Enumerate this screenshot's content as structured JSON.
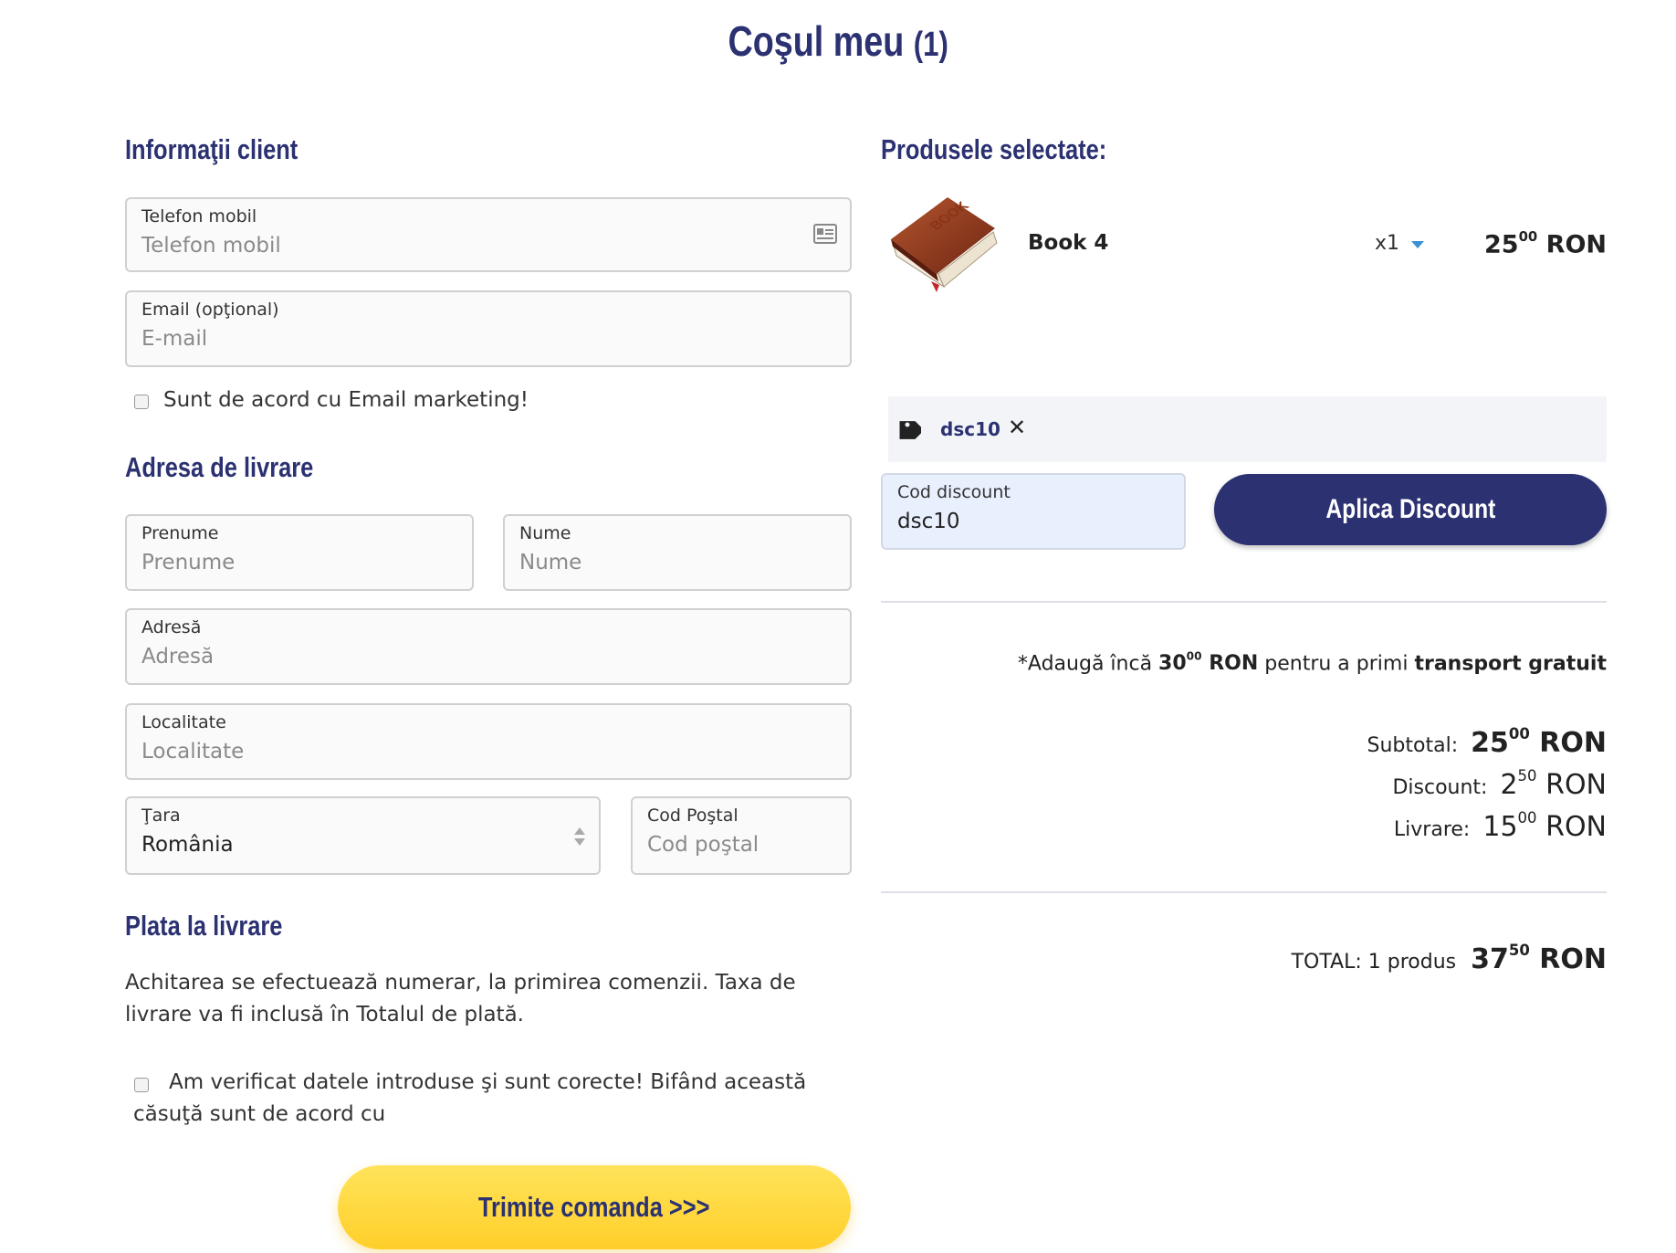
{
  "page": {
    "title": "Coşul meu",
    "count": "(1)"
  },
  "client": {
    "heading": "Informaţii client",
    "phone": {
      "label": "Telefon mobil",
      "placeholder": "Telefon mobil",
      "icon": "contact-card-icon"
    },
    "email": {
      "label": "Email (opţional)",
      "placeholder": "E-mail"
    },
    "marketing_label": "Sunt de acord cu Email marketing!"
  },
  "shipping": {
    "heading": "Adresa de livrare",
    "first_name": {
      "label": "Prenume",
      "placeholder": "Prenume"
    },
    "last_name": {
      "label": "Nume",
      "placeholder": "Nume"
    },
    "address": {
      "label": "Adresă",
      "placeholder": "Adresă"
    },
    "city": {
      "label": "Localitate",
      "placeholder": "Localitate"
    },
    "country": {
      "label": "Ţara",
      "value": "România"
    },
    "postal": {
      "label": "Cod Poştal",
      "placeholder": "Cod poştal"
    }
  },
  "payment": {
    "heading": "Plata la livrare",
    "description": "Achitarea se efectuează numerar, la primirea comenzii. Taxa de livrare va fi inclusă în Totalul de plată.",
    "terms_label": "Am verificat datele introduse şi sunt corecte! Bifând această căsuţă sunt de acord cu",
    "submit_label": "Trimite comanda >>>"
  },
  "products": {
    "heading": "Produsele selectate:",
    "items": [
      {
        "name": "Book 4",
        "image_label": "BOOK",
        "qty": "x1",
        "price_int": "25",
        "price_dec": "00",
        "currency": "RON"
      }
    ]
  },
  "discount": {
    "applied_code": "dsc10",
    "remove_symbol": "✕",
    "input_label": "Cod discount",
    "input_value": "dsc10",
    "apply_label": "Aplica Discount"
  },
  "shipping_note": {
    "prefix": "*Adaugă încă",
    "amount_int": "30",
    "amount_dec": "00",
    "currency": "RON",
    "middle": "pentru a primi",
    "bold_end": "transport gratuit"
  },
  "summary": {
    "subtotal_label": "Subtotal:",
    "subtotal_int": "25",
    "subtotal_dec": "00",
    "discount_label": "Discount:",
    "discount_int": "2",
    "discount_dec": "50",
    "delivery_label": "Livrare:",
    "delivery_int": "15",
    "delivery_dec": "00",
    "currency": "RON",
    "total_label": "TOTAL: 1 produs",
    "total_int": "37",
    "total_dec": "50"
  },
  "colors": {
    "navy": "#2b3171",
    "yellow": "#ffd53a",
    "input_active": "#e8f0fe"
  }
}
